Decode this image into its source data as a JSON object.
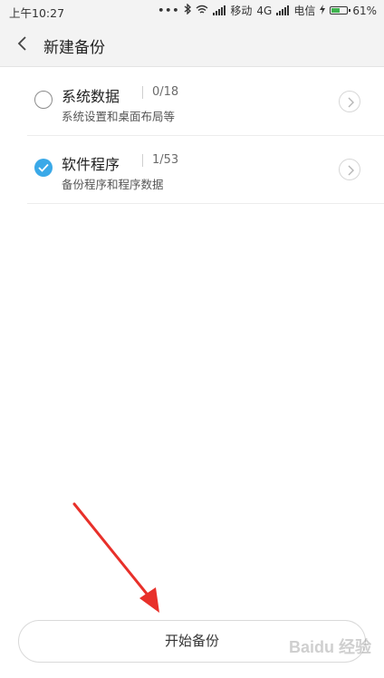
{
  "status_bar": {
    "time": "上午10:27",
    "dots": "•••",
    "carrier1_net": "移动",
    "network_type": "4G",
    "carrier2": "电信",
    "battery_percent": "61%",
    "battery_level": 0.61,
    "battery_color": "#3fb34f"
  },
  "title_bar": {
    "title": "新建备份"
  },
  "items": [
    {
      "title": "系统数据",
      "count": "0/18",
      "subtitle": "系统设置和桌面布局等",
      "checked": false
    },
    {
      "title": "软件程序",
      "count": "1/53",
      "subtitle": "备份程序和程序数据",
      "checked": true
    }
  ],
  "start_button": {
    "label": "开始备份"
  },
  "colors": {
    "accent": "#3aa9e8",
    "annotation_arrow": "#e8302a"
  },
  "watermark": {
    "text": "Baidu 经验"
  }
}
